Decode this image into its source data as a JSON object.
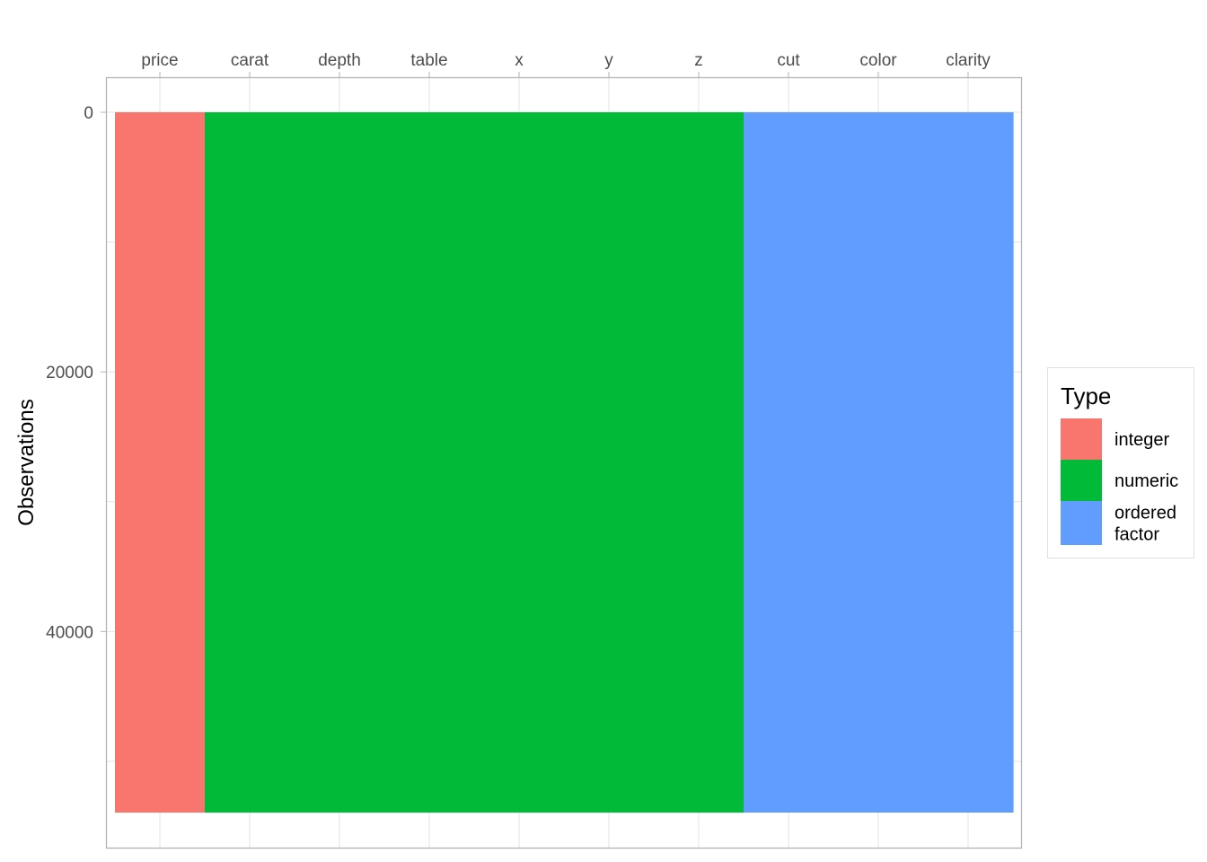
{
  "chart_data": {
    "type": "heatmap",
    "x_categories": [
      "price",
      "carat",
      "depth",
      "table",
      "x",
      "y",
      "z",
      "cut",
      "color",
      "clarity"
    ],
    "column_types": [
      "integer",
      "numeric",
      "numeric",
      "numeric",
      "numeric",
      "numeric",
      "numeric",
      "ordered\nfactor",
      "ordered\nfactor",
      "ordered\nfactor"
    ],
    "observations": 53940,
    "ylabel": "Observations",
    "xlabel": "",
    "ylim": [
      -2700,
      56640
    ],
    "y_reversed": true,
    "y_ticks": [
      0,
      20000,
      40000
    ],
    "x_axis_position": "top",
    "grid": true,
    "legend": {
      "title": "Type",
      "position": "right",
      "entries": [
        {
          "label": "integer",
          "color": "#F8766D"
        },
        {
          "label": "numeric",
          "color": "#00BA38"
        },
        {
          "label": "ordered\nfactor",
          "color": "#619CFF"
        }
      ]
    }
  }
}
